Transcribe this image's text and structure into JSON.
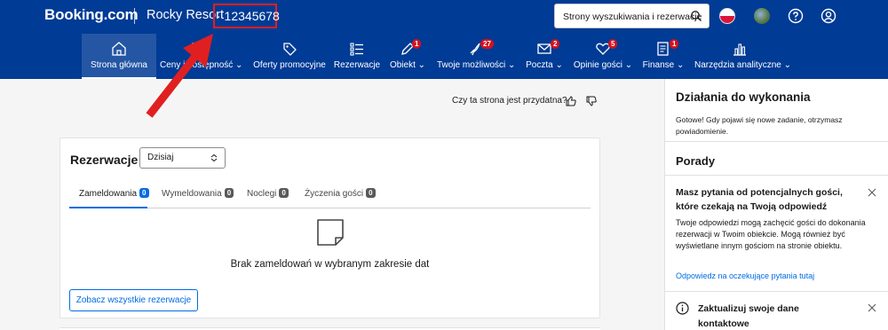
{
  "header": {
    "brand": "Booking.com",
    "property_name": "Rocky Resort",
    "property_id": "· 12345678",
    "search_label": "Strony wyszukiwania i rezerwacje"
  },
  "nav": [
    {
      "label": "Strona główna",
      "icon": "home-icon",
      "badge": ""
    },
    {
      "label": "Ceny i dostępność ⌄",
      "icon": "calendar-icon",
      "badge": ""
    },
    {
      "label": "Oferty promocyjne",
      "icon": "tag-icon",
      "badge": ""
    },
    {
      "label": "Rezerwacje",
      "icon": "list-icon",
      "badge": ""
    },
    {
      "label": "Obiekt ⌄",
      "icon": "pencil-icon",
      "badge": "1"
    },
    {
      "label": "Twoje możliwości ⌄",
      "icon": "rocket-icon",
      "badge": "27"
    },
    {
      "label": "Poczta ⌄",
      "icon": "mail-icon",
      "badge": "2"
    },
    {
      "label": "Opinie gości ⌄",
      "icon": "heart-icon",
      "badge": "5"
    },
    {
      "label": "Finanse ⌄",
      "icon": "invoice-icon",
      "badge": "1"
    },
    {
      "label": "Narzędzia analityczne ⌄",
      "icon": "bar-chart-icon",
      "badge": ""
    }
  ],
  "content": {
    "helpful_question": "Czy ta strona jest przydatna?",
    "reservations": {
      "title": "Rezerwacje",
      "period": "Dzisiaj",
      "tabs": [
        {
          "label": "Zameldowania",
          "count": "0"
        },
        {
          "label": "Wymeldowania",
          "count": "0"
        },
        {
          "label": "Noclegi",
          "count": "0"
        },
        {
          "label": "Życzenia gości",
          "count": "0"
        }
      ],
      "empty_message": "Brak zameldowań w wybranym zakresie dat",
      "view_all_button": "Zobacz wszystkie rezerwacje"
    }
  },
  "sidebar": {
    "todo_title": "Działania do wykonania",
    "todo_text": "Gotowe! Gdy pojawi się nowe zadanie, otrzymasz powiadomienie.",
    "tips_title": "Porady",
    "tip1_title": "Masz pytania od potencjalnych gości, które czekają na Twoją odpowiedź",
    "tip1_body": "Twoje odpowiedzi mogą zachęcić gości do dokonania rezerwacji w Twoim obiekcie. Mogą również być wyświetlane innym gościom na stronie obiektu.",
    "tip1_link": "Odpowiedz na oczekujące pytania tutaj",
    "tip2_title": "Zaktualizuj swoje dane kontaktowe"
  },
  "colors": {
    "header_bg": "#003b95",
    "accent": "#006ce4",
    "badge_red": "#d4111e",
    "annotation_red": "#e02020"
  }
}
